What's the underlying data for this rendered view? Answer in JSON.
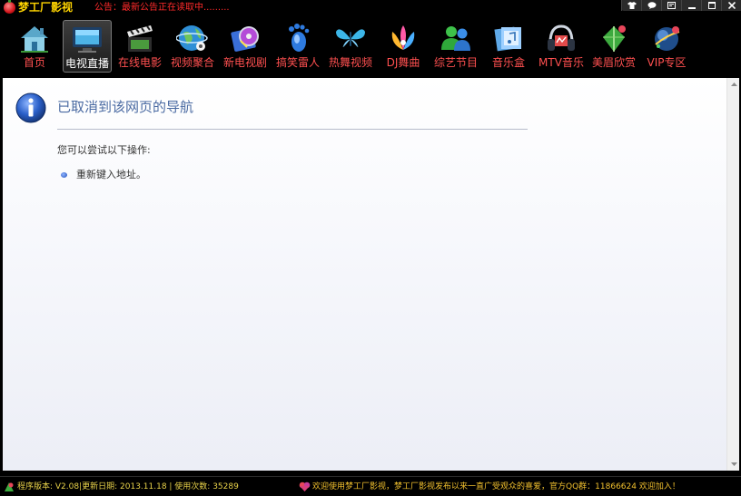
{
  "app": {
    "title": "梦工厂影视",
    "notice": "公告：最新公告正在读取中........."
  },
  "window_controls": [
    {
      "name": "skin-button",
      "icon": "tshirt-icon"
    },
    {
      "name": "feedback-button",
      "icon": "chat-bubble-icon"
    },
    {
      "name": "settings-button",
      "icon": "window-settings-icon"
    },
    {
      "name": "minimize-button",
      "icon": "minimize-icon"
    },
    {
      "name": "maximize-button",
      "icon": "maximize-icon"
    },
    {
      "name": "close-button",
      "icon": "close-icon"
    }
  ],
  "nav": {
    "active_index": 1,
    "items": [
      {
        "label": "首页",
        "icon": "house-icon"
      },
      {
        "label": "电视直播",
        "icon": "tv-icon"
      },
      {
        "label": "在线电影",
        "icon": "film-reel-icon"
      },
      {
        "label": "视频聚合",
        "icon": "globe-icon"
      },
      {
        "label": "新电视剧",
        "icon": "dvd-icon"
      },
      {
        "label": "搞笑雷人",
        "icon": "footprint-icon"
      },
      {
        "label": "热舞视频",
        "icon": "butterfly-icon"
      },
      {
        "label": "DJ舞曲",
        "icon": "dj-icon"
      },
      {
        "label": "综艺节目",
        "icon": "people-icon"
      },
      {
        "label": "音乐盒",
        "icon": "music-box-icon"
      },
      {
        "label": "MTV音乐",
        "icon": "headphones-icon"
      },
      {
        "label": "美眉欣赏",
        "icon": "leaf-icon"
      },
      {
        "label": "VIP专区",
        "icon": "vip-globe-icon"
      }
    ]
  },
  "page": {
    "title": "已取消到该网页的导航",
    "subtext": "您可以尝试以下操作:",
    "suggestion": "重新键入地址。"
  },
  "status": {
    "version_text": "程序版本: V2.08|更新日期: 2013.11.18 | 使用次数: 35289",
    "welcome_text": "欢迎使用梦工厂影视，梦工厂影视发布以来一直广受观众的喜爱，官方QQ群：11866624 欢迎加入！"
  },
  "colors": {
    "background": "#000000",
    "title": "#ffd400",
    "notice": "#ff2a2a",
    "nav_label": "#ff5050",
    "page_title": "#4a6aa2",
    "status_text": "#e8d24a"
  }
}
